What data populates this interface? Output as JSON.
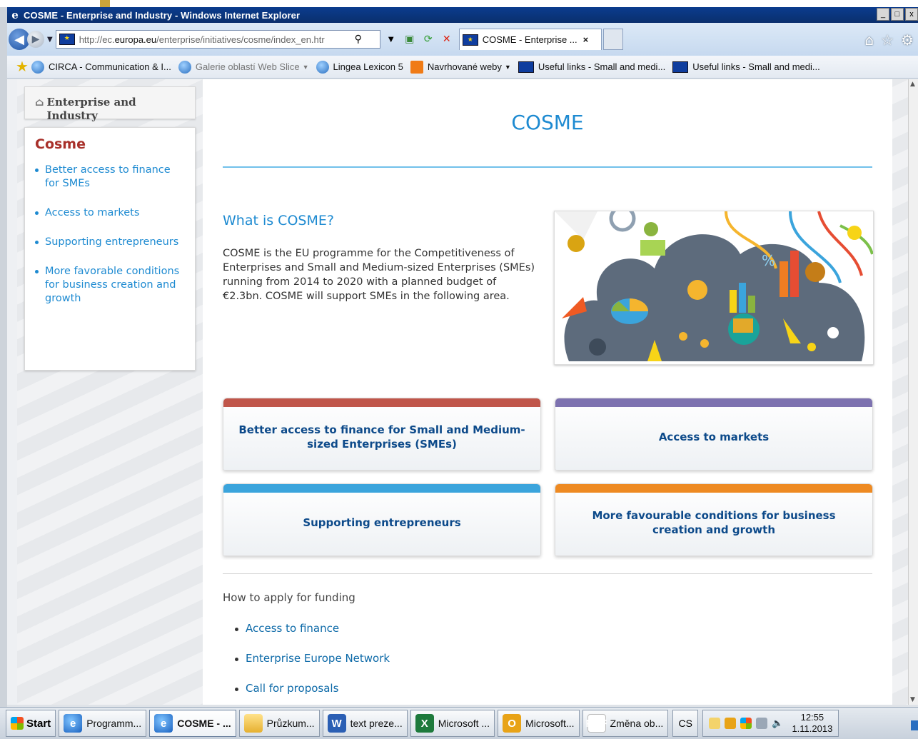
{
  "window": {
    "title": "COSME - Enterprise and Industry - Windows Internet Explorer",
    "controls": [
      "_",
      "□",
      "x"
    ]
  },
  "navbar": {
    "url_prefix": "http://ec.",
    "url_domain": "europa.eu",
    "url_path": "/enterprise/initiatives/cosme/index_en.htr",
    "tab_title": "COSME - Enterprise ...",
    "tab_close": "×"
  },
  "favorites": {
    "items": [
      {
        "label": "CIRCA - Communication & I...",
        "icon": "ie-page-icon"
      },
      {
        "label": "Galerie oblastí Web Slice",
        "icon": "ie-page-icon",
        "dropdown": true
      },
      {
        "label": "Lingea Lexicon 5",
        "icon": "ie-page-icon"
      },
      {
        "label": "Navrhované weby",
        "icon": "suggested-sites-icon",
        "dropdown": true
      },
      {
        "label": "Useful links - Small and medi...",
        "icon": "eu-flag-icon"
      },
      {
        "label": "Useful links - Small and medi...",
        "icon": "eu-flag-icon"
      }
    ]
  },
  "sidebar": {
    "top_label": "Enterprise and Industry",
    "heading": "Cosme",
    "items": [
      "Better access to finance for SMEs",
      "Access to markets",
      "Supporting entrepreneurs",
      "More favorable conditions for business creation and growth"
    ]
  },
  "main": {
    "title": "COSME",
    "what_heading": "What is COSME?",
    "what_text": "COSME is the EU programme for the Competitiveness of Enterprises and Small and Medium-sized Enterprises (SMEs) running from 2014 to 2020 with a planned budget of €2.3bn. COSME will support SMEs in the following area.",
    "boxes": [
      {
        "label": "Better access to finance for Small and Medium-sized Enterprises (SMEs)",
        "color": "#c0564a"
      },
      {
        "label": "Access to markets",
        "color": "#7d72b0"
      },
      {
        "label": "Supporting entrepreneurs",
        "color": "#3ba4dc"
      },
      {
        "label": "More favourable conditions for business creation and growth",
        "color": "#ee8a22"
      }
    ],
    "howto_heading": "How to apply for funding",
    "links": [
      "Access to finance",
      "Enterprise Europe Network",
      "Call for proposals"
    ]
  },
  "taskbar": {
    "start": "Start",
    "tasks": [
      {
        "label": "Programm...",
        "icon": "ie-icon"
      },
      {
        "label": "COSME - ...",
        "icon": "ie-icon",
        "active": true
      },
      {
        "label": "Průzkum...",
        "icon": "folder-icon"
      },
      {
        "label": "text preze...",
        "icon": "word-icon"
      },
      {
        "label": "Microsoft ...",
        "icon": "excel-icon"
      },
      {
        "label": "Microsoft...",
        "icon": "outlook-icon"
      },
      {
        "label": "Změna ob...",
        "icon": "pdf-icon"
      }
    ],
    "language": "CS",
    "time": "12:55",
    "date": "1.11.2013"
  },
  "colors": {
    "accent_blue": "#1d8ad1",
    "cosme_red": "#a8302a",
    "box_text": "#0d4a8a"
  }
}
